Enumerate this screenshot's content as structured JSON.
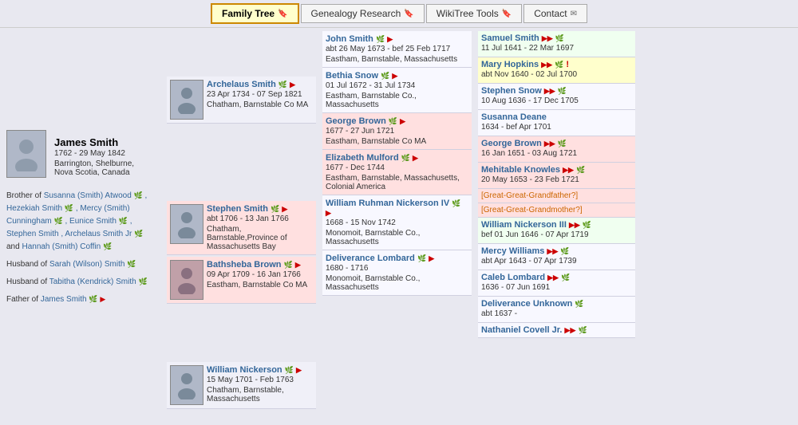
{
  "navbar": {
    "tabs": [
      {
        "label": "Family Tree",
        "icon": "🔖",
        "active": true
      },
      {
        "label": "Genealogy Research",
        "icon": "🔖",
        "active": false
      },
      {
        "label": "WikiTree Tools",
        "icon": "🔖",
        "active": false
      },
      {
        "label": "Contact",
        "icon": "✉",
        "active": false
      }
    ]
  },
  "james_smith": {
    "name": "James Smith",
    "dates": "1762 - 29 May 1842",
    "location": "Barrington, Shelburne, Nova Scotia, Canada",
    "siblings_label": "Brother of",
    "siblings": [
      "Susanna (Smith) Atwood",
      "Hezekiah Smith",
      "Mercy (Smith) Cunningham",
      "Eunice Smith",
      "Stephen Smith",
      "Archelaus Smith Jr",
      "Hannah (Smith) Coffin"
    ],
    "spouse1_label": "Husband of",
    "spouse1": "Sarah (Wilson) Smith",
    "spouse2_label": "Husband of",
    "spouse2": "Tabitha (Kendrick) Smith",
    "father_label": "Father of",
    "father_link": "James Smith"
  },
  "archelaus_smith": {
    "name": "Archelaus Smith",
    "dates": "23 Apr 1734 - 07 Sep 1821",
    "location": "Chatham, Barnstable Co MA"
  },
  "stephen_smith": {
    "name": "Stephen Smith",
    "dates": "abt 1706 - 13 Jan 1766",
    "location": "Chatham, Barnstable,Province of Massachusetts Bay"
  },
  "bathsheba_brown": {
    "name": "Bathsheba Brown",
    "dates": "09 Apr 1709 - 16 Jan 1766",
    "location": "Eastham, Barnstable Co MA"
  },
  "william_nickerson": {
    "name": "William Nickerson",
    "dates": "15 May 1701 - Feb 1763",
    "location": "Chatham, Barnstable, Massachusetts"
  },
  "john_smith": {
    "name": "John Smith",
    "dates": "abt 26 May 1673 - bef 25 Feb 1717",
    "location": "Eastham, Barnstable, Massachusetts"
  },
  "bethia_snow": {
    "name": "Bethia Snow",
    "dates": "01 Jul 1672 - 31 Jul 1734",
    "location": "Eastham, Barnstable Co., Massachusetts"
  },
  "george_brown_1": {
    "name": "George Brown",
    "dates": "1677 - 27 Jun 1721",
    "location": "Eastham, Barnstable Co MA"
  },
  "elizabeth_mulford": {
    "name": "Elizabeth Mulford",
    "dates": "1677 - Dec 1744",
    "location": "Eastham, Barnstable, Massachusetts, Colonial America"
  },
  "william_nickerson_iv": {
    "name": "William Ruhman Nickerson IV",
    "dates": "1668 - 15 Nov 1742",
    "location": "Monomoit, Barnstable Co., Massachusetts"
  },
  "deliverance_lombard": {
    "name": "Deliverance Lombard",
    "dates": "1680 - 1716",
    "location": "Monomoit, Barnstable Co., Massachusetts"
  },
  "samuel_smith": {
    "name": "Samuel Smith",
    "dates": "11 Jul 1641 - 22 Mar 1697"
  },
  "mary_hopkins": {
    "name": "Mary Hopkins",
    "dates": "abt Nov 1640 - 02 Jul 1700"
  },
  "stephen_snow": {
    "name": "Stephen Snow",
    "dates": "10 Aug 1636 - 17 Dec 1705"
  },
  "susanna_deane": {
    "name": "Susanna Deane",
    "dates": "1634 - bef Apr 1701"
  },
  "george_brown_2": {
    "name": "George Brown",
    "dates": "16 Jan 1651 - 03 Aug 1721"
  },
  "mehitable_knowles": {
    "name": "Mehitable Knowles",
    "dates": "20 May 1653 - 23 Feb 1721"
  },
  "great_great_grandfather": {
    "label": "[Great-Great-Grandfather?]"
  },
  "great_great_grandmother": {
    "label": "[Great-Great-Grandmother?]"
  },
  "william_nickerson_iii": {
    "name": "William Nickerson III",
    "dates": "bef 01 Jun 1646 - 07 Apr 1719"
  },
  "mercy_williams": {
    "name": "Mercy Williams",
    "dates": "abt Apr 1643 - 07 Apr 1739"
  },
  "caleb_lombard": {
    "name": "Caleb Lombard",
    "dates": "1636 - 07 Jun 1691"
  },
  "deliverance_unknown": {
    "name": "Deliverance Unknown",
    "dates": "abt 1637 -"
  },
  "nathaniel_covell": {
    "name": "Nathaniel Covell Jr.",
    "dates": ""
  }
}
